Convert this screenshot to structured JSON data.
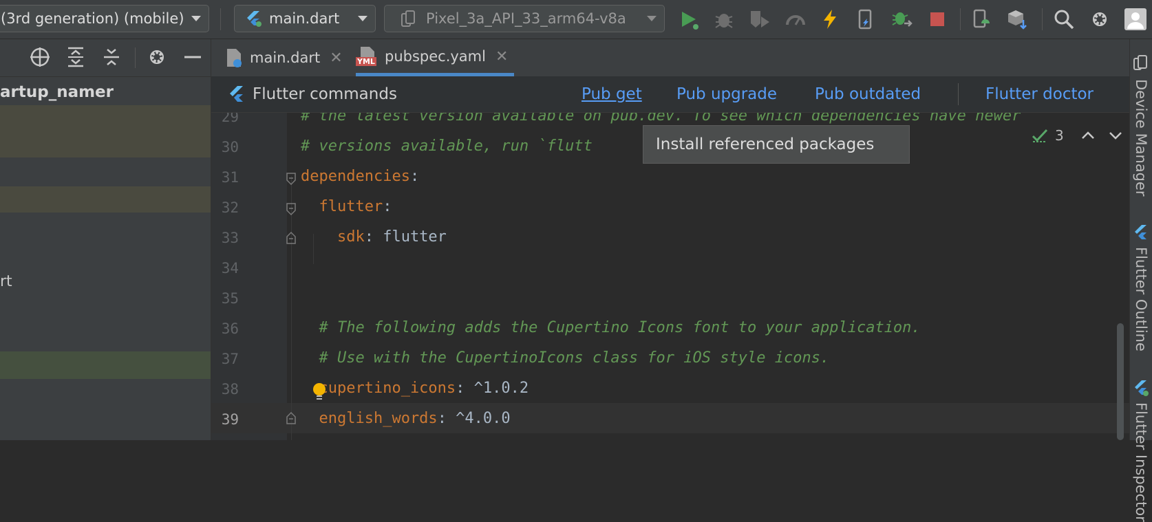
{
  "toolbar": {
    "device_config": "(3rd generation) (mobile)",
    "run_config": "main.dart",
    "device": "Pixel_3a_API_33_arm64-v8a"
  },
  "project_panel": {
    "root_label": "artup_namer",
    "partial_item": "rt"
  },
  "tabs": [
    {
      "label": "main.dart"
    },
    {
      "label": "pubspec.yaml",
      "badge": "YML"
    }
  ],
  "flutter_commands": {
    "title": "Flutter commands",
    "pub_get": "Pub get",
    "pub_upgrade": "Pub upgrade",
    "pub_outdated": "Pub outdated",
    "flutter_doctor": "Flutter doctor"
  },
  "tooltip": "Install referenced packages",
  "inspections": {
    "count": "3"
  },
  "editor": {
    "lines": [
      {
        "num": "29",
        "parts": [
          {
            "t": "# the latest version available on pub.dev. To see which dependencies have newer",
            "c": "cm"
          }
        ]
      },
      {
        "num": "30",
        "parts": [
          {
            "t": "# versions available, run `flutt",
            "c": "cm"
          }
        ]
      },
      {
        "num": "31",
        "parts": [
          {
            "t": "dependencies",
            "c": "key"
          },
          {
            "t": ":",
            "c": "txt"
          }
        ]
      },
      {
        "num": "32",
        "parts": [
          {
            "t": "  flutter",
            "c": "key"
          },
          {
            "t": ":",
            "c": "txt"
          }
        ]
      },
      {
        "num": "33",
        "parts": [
          {
            "t": "    sdk",
            "c": "key"
          },
          {
            "t": ": flutter",
            "c": "txt"
          }
        ]
      },
      {
        "num": "34",
        "parts": []
      },
      {
        "num": "35",
        "parts": []
      },
      {
        "num": "36",
        "parts": [
          {
            "t": "  # The following adds the Cupertino Icons font to your application.",
            "c": "cm"
          }
        ]
      },
      {
        "num": "37",
        "parts": [
          {
            "t": "  # Use with the CupertinoIcons class for iOS style icons.",
            "c": "cm"
          }
        ]
      },
      {
        "num": "38",
        "parts": [
          {
            "t": "  cupertino_icons",
            "c": "key"
          },
          {
            "t": ": ^1.0.2",
            "c": "txt"
          }
        ]
      },
      {
        "num": "39",
        "parts": [
          {
            "t": "  english_words",
            "c": "key"
          },
          {
            "t": ": ^4.0.0",
            "c": "txt"
          }
        ]
      }
    ]
  },
  "right_tools": {
    "device_manager": "Device Manager",
    "flutter_outline": "Flutter Outline",
    "flutter_inspector": "Flutter Inspector"
  },
  "colors": {
    "accent_link": "#589df6",
    "run_green": "#499c54",
    "stop_red": "#c75450",
    "comment": "#629755",
    "keyword": "#cc7832"
  }
}
